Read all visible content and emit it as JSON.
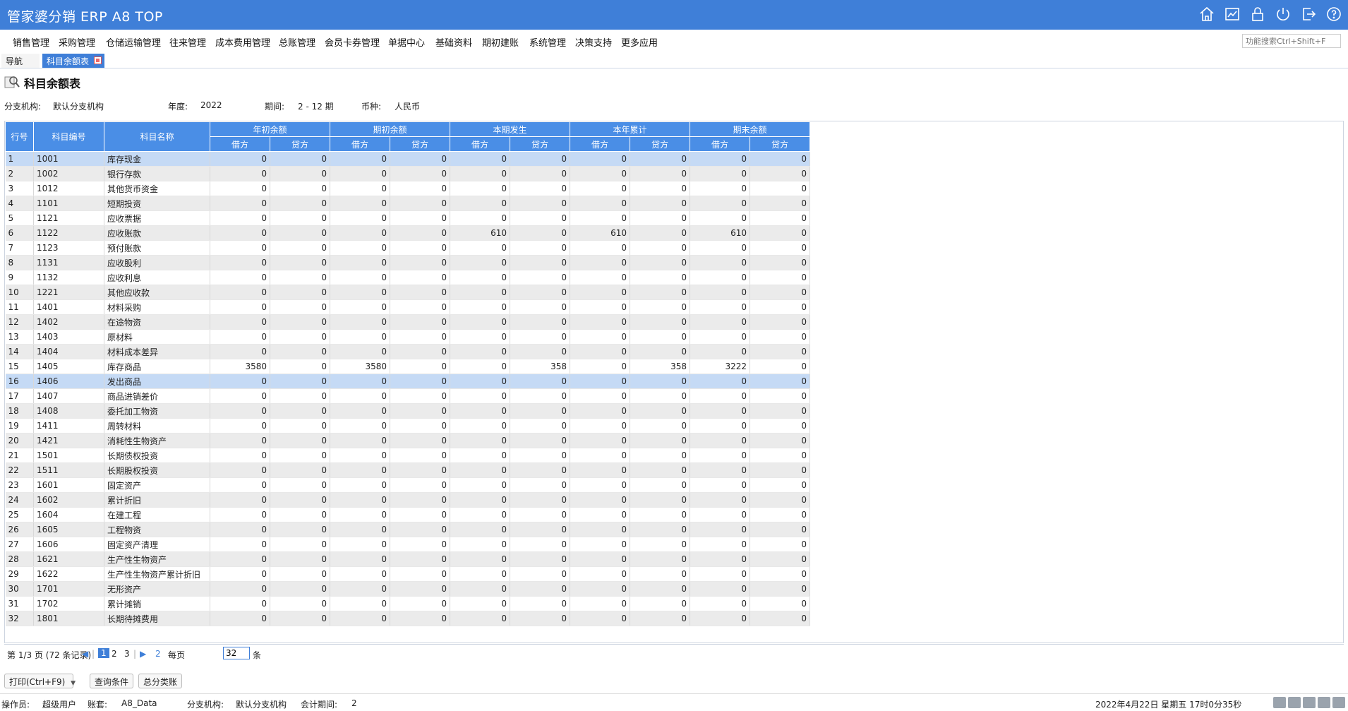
{
  "app": {
    "title": "管家婆分销 ERP A8 TOP",
    "search_placeholder": "功能搜索Ctrl+Shift+F"
  },
  "toolbar_icons": [
    "home-icon",
    "chart-icon",
    "lock-icon",
    "power-icon",
    "exit-icon",
    "help-icon"
  ],
  "menu": [
    "销售管理",
    "采购管理",
    "仓储运输管理",
    "往来管理",
    "成本费用管理",
    "总账管理",
    "会员卡券管理",
    "单据中心",
    "基础资料",
    "期初建账",
    "系统管理",
    "决策支持",
    "更多应用"
  ],
  "tabs": {
    "nav": "导航",
    "active": "科目余额表"
  },
  "page": {
    "title": "科目余额表"
  },
  "filters": {
    "branch_label": "分支机构:",
    "branch_value": "默认分支机构",
    "year_label": "年度:",
    "year_value": "2022",
    "period_label": "期间:",
    "period_value": "2 - 12 期",
    "currency_label": "币种:",
    "currency_value": "人民币"
  },
  "table": {
    "headers": {
      "idx": "行号",
      "code": "科目编号",
      "name": "科目名称",
      "groups": [
        "年初余额",
        "期初余额",
        "本期发生",
        "本年累计",
        "期末余额"
      ],
      "debit": "借方",
      "credit": "贷方"
    },
    "rows": [
      [
        "1",
        "1001",
        "库存现金",
        "0",
        "0",
        "0",
        "0",
        "0",
        "0",
        "0",
        "0",
        "0",
        "0"
      ],
      [
        "2",
        "1002",
        "银行存款",
        "0",
        "0",
        "0",
        "0",
        "0",
        "0",
        "0",
        "0",
        "0",
        "0"
      ],
      [
        "3",
        "1012",
        "其他货币资金",
        "0",
        "0",
        "0",
        "0",
        "0",
        "0",
        "0",
        "0",
        "0",
        "0"
      ],
      [
        "4",
        "1101",
        "短期投资",
        "0",
        "0",
        "0",
        "0",
        "0",
        "0",
        "0",
        "0",
        "0",
        "0"
      ],
      [
        "5",
        "1121",
        "应收票据",
        "0",
        "0",
        "0",
        "0",
        "0",
        "0",
        "0",
        "0",
        "0",
        "0"
      ],
      [
        "6",
        "1122",
        "应收账款",
        "0",
        "0",
        "0",
        "0",
        "610",
        "0",
        "610",
        "0",
        "610",
        "0"
      ],
      [
        "7",
        "1123",
        "预付账款",
        "0",
        "0",
        "0",
        "0",
        "0",
        "0",
        "0",
        "0",
        "0",
        "0"
      ],
      [
        "8",
        "1131",
        "应收股利",
        "0",
        "0",
        "0",
        "0",
        "0",
        "0",
        "0",
        "0",
        "0",
        "0"
      ],
      [
        "9",
        "1132",
        "应收利息",
        "0",
        "0",
        "0",
        "0",
        "0",
        "0",
        "0",
        "0",
        "0",
        "0"
      ],
      [
        "10",
        "1221",
        "其他应收款",
        "0",
        "0",
        "0",
        "0",
        "0",
        "0",
        "0",
        "0",
        "0",
        "0"
      ],
      [
        "11",
        "1401",
        "材料采购",
        "0",
        "0",
        "0",
        "0",
        "0",
        "0",
        "0",
        "0",
        "0",
        "0"
      ],
      [
        "12",
        "1402",
        "在途物资",
        "0",
        "0",
        "0",
        "0",
        "0",
        "0",
        "0",
        "0",
        "0",
        "0"
      ],
      [
        "13",
        "1403",
        "原材料",
        "0",
        "0",
        "0",
        "0",
        "0",
        "0",
        "0",
        "0",
        "0",
        "0"
      ],
      [
        "14",
        "1404",
        "材料成本差异",
        "0",
        "0",
        "0",
        "0",
        "0",
        "0",
        "0",
        "0",
        "0",
        "0"
      ],
      [
        "15",
        "1405",
        "库存商品",
        "3580",
        "0",
        "3580",
        "0",
        "0",
        "358",
        "0",
        "358",
        "3222",
        "0"
      ],
      [
        "16",
        "1406",
        "发出商品",
        "0",
        "0",
        "0",
        "0",
        "0",
        "0",
        "0",
        "0",
        "0",
        "0"
      ],
      [
        "17",
        "1407",
        "商品进销差价",
        "0",
        "0",
        "0",
        "0",
        "0",
        "0",
        "0",
        "0",
        "0",
        "0"
      ],
      [
        "18",
        "1408",
        "委托加工物资",
        "0",
        "0",
        "0",
        "0",
        "0",
        "0",
        "0",
        "0",
        "0",
        "0"
      ],
      [
        "19",
        "1411",
        "周转材料",
        "0",
        "0",
        "0",
        "0",
        "0",
        "0",
        "0",
        "0",
        "0",
        "0"
      ],
      [
        "20",
        "1421",
        "消耗性生物资产",
        "0",
        "0",
        "0",
        "0",
        "0",
        "0",
        "0",
        "0",
        "0",
        "0"
      ],
      [
        "21",
        "1501",
        "长期债权投资",
        "0",
        "0",
        "0",
        "0",
        "0",
        "0",
        "0",
        "0",
        "0",
        "0"
      ],
      [
        "22",
        "1511",
        "长期股权投资",
        "0",
        "0",
        "0",
        "0",
        "0",
        "0",
        "0",
        "0",
        "0",
        "0"
      ],
      [
        "23",
        "1601",
        "固定资产",
        "0",
        "0",
        "0",
        "0",
        "0",
        "0",
        "0",
        "0",
        "0",
        "0"
      ],
      [
        "24",
        "1602",
        "累计折旧",
        "0",
        "0",
        "0",
        "0",
        "0",
        "0",
        "0",
        "0",
        "0",
        "0"
      ],
      [
        "25",
        "1604",
        "在建工程",
        "0",
        "0",
        "0",
        "0",
        "0",
        "0",
        "0",
        "0",
        "0",
        "0"
      ],
      [
        "26",
        "1605",
        "工程物资",
        "0",
        "0",
        "0",
        "0",
        "0",
        "0",
        "0",
        "0",
        "0",
        "0"
      ],
      [
        "27",
        "1606",
        "固定资产清理",
        "0",
        "0",
        "0",
        "0",
        "0",
        "0",
        "0",
        "0",
        "0",
        "0"
      ],
      [
        "28",
        "1621",
        "生产性生物资产",
        "0",
        "0",
        "0",
        "0",
        "0",
        "0",
        "0",
        "0",
        "0",
        "0"
      ],
      [
        "29",
        "1622",
        "生产性生物资产累计折旧",
        "0",
        "0",
        "0",
        "0",
        "0",
        "0",
        "0",
        "0",
        "0",
        "0"
      ],
      [
        "30",
        "1701",
        "无形资产",
        "0",
        "0",
        "0",
        "0",
        "0",
        "0",
        "0",
        "0",
        "0",
        "0"
      ],
      [
        "31",
        "1702",
        "累计摊销",
        "0",
        "0",
        "0",
        "0",
        "0",
        "0",
        "0",
        "0",
        "0",
        "0"
      ],
      [
        "32",
        "1801",
        "长期待摊费用",
        "0",
        "0",
        "0",
        "0",
        "0",
        "0",
        "0",
        "0",
        "0",
        "0"
      ]
    ],
    "selected_rows": [
      1,
      16
    ]
  },
  "pager": {
    "summary": "第 1/3 页 (72 条记录)",
    "pages": [
      "1",
      "2",
      "3"
    ],
    "last": "2",
    "per_page_label": "每页",
    "per_page_value": "32",
    "per_page_unit": "条"
  },
  "actions": {
    "print": "打印(Ctrl+F9)",
    "query": "查询条件",
    "ledger": "总分类账"
  },
  "status": {
    "operator_label": "操作员:",
    "operator": "超级用户",
    "account_label": "账套:",
    "account": "A8_Data",
    "branch_label": "分支机构:",
    "branch": "默认分支机构",
    "period_label": "会计期间:",
    "period": "2",
    "datetime": "2022年4月22日 星期五 17时0分35秒"
  }
}
